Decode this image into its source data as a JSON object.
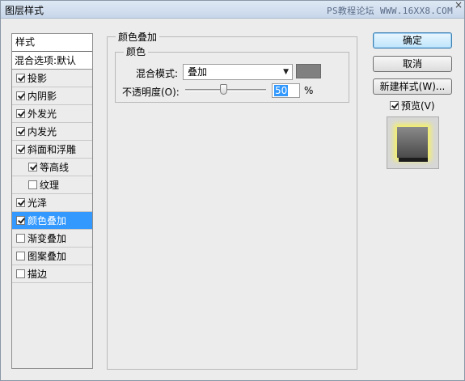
{
  "window": {
    "title": "图层样式",
    "watermark": "PS教程论坛 WWW.16XX8.COM",
    "close": "×"
  },
  "stylelist": {
    "header": "样式",
    "blend_options": "混合选项:默认",
    "items": [
      {
        "label": "投影",
        "checked": true,
        "sub": false,
        "selected": false
      },
      {
        "label": "内阴影",
        "checked": true,
        "sub": false,
        "selected": false
      },
      {
        "label": "外发光",
        "checked": true,
        "sub": false,
        "selected": false
      },
      {
        "label": "内发光",
        "checked": true,
        "sub": false,
        "selected": false
      },
      {
        "label": "斜面和浮雕",
        "checked": true,
        "sub": false,
        "selected": false
      },
      {
        "label": "等高线",
        "checked": true,
        "sub": true,
        "selected": false
      },
      {
        "label": "纹理",
        "checked": false,
        "sub": true,
        "selected": false
      },
      {
        "label": "光泽",
        "checked": true,
        "sub": false,
        "selected": false
      },
      {
        "label": "颜色叠加",
        "checked": true,
        "sub": false,
        "selected": true
      },
      {
        "label": "渐变叠加",
        "checked": false,
        "sub": false,
        "selected": false
      },
      {
        "label": "图案叠加",
        "checked": false,
        "sub": false,
        "selected": false
      },
      {
        "label": "描边",
        "checked": false,
        "sub": false,
        "selected": false
      }
    ]
  },
  "panel": {
    "group_title": "颜色叠加",
    "subgroup_title": "颜色",
    "blend_mode_label": "混合模式:",
    "blend_mode_value": "叠加",
    "overlay_color": "#808080",
    "opacity_label": "不透明度(O):",
    "opacity_value": "50",
    "opacity_unit": "%"
  },
  "buttons": {
    "ok": "确定",
    "cancel": "取消",
    "new_style": "新建样式(W)...",
    "preview_label": "预览(V)",
    "preview_checked": true
  }
}
